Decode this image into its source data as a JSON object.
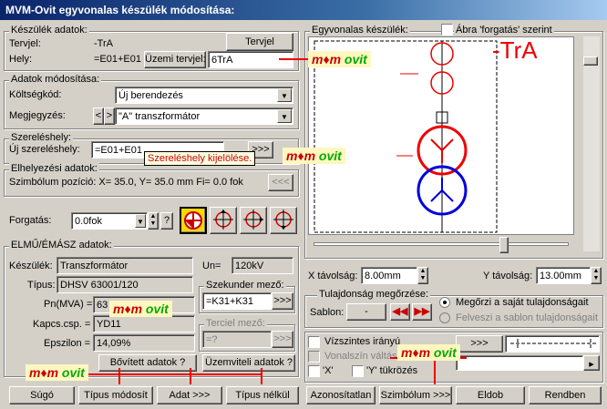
{
  "title": "MVM-Ovit egyvonalas készülék módosítása:",
  "keszulek": {
    "legend": "Készülék adatok:",
    "terv_label": "Tervjel:",
    "terv_value": "-TrA",
    "tervjel_button": "Tervjel",
    "hely_label": "Hely:",
    "hely_value": "=E01+E01",
    "uzemi_button": "Üzemi tervjel:",
    "uzemi_value": "6TrA"
  },
  "adatok": {
    "legend": "Adatok módosítása:",
    "koltseg_label": "Költségkód:",
    "koltseg_value": "Új berendezés",
    "megjegy_label": "Megjegyzés:",
    "prev": "<",
    "next": ">",
    "megjegy_value": "\"A\" transzformátor"
  },
  "szerelo": {
    "legend": "Szereléshely:",
    "uj_label": "Új szereléshely:",
    "uj_value": "=E01+E01",
    "pick": ">>>",
    "tooltip": "Szereléshely kijelölése."
  },
  "elhelyez": {
    "legend": "Elhelyezési adatok:",
    "text": "Szimbólum pozíció: X=  35.0, Y=  35.0 mm Fi=    0.0 fok",
    "back": "<<<"
  },
  "forgatas": {
    "label": "Forgatás:",
    "value": "0.0fok",
    "help": "?"
  },
  "elmu": {
    "legend": "ELMŰ/ÉMÁSZ adatok:",
    "keszulek_label": "Készülék:",
    "keszulek_value": "Transzformátor",
    "un_label": "Un=",
    "un_value": "120kV",
    "tipus_label": "Típus:",
    "tipus_value": "DHSV 63001/120",
    "pn_label": "Pn(MVA) =",
    "pn_value": "63",
    "kapcs_label": "Kapcs.csp. =",
    "kapcs_value": "YD11",
    "eps_label": "Epszilon =",
    "eps_value": "14,09%",
    "szek_legend": "Szekunder mező:",
    "szek_value": "=K31+K31",
    "szek_btn": ">>>",
    "terc_legend": "Terciel mező:",
    "terc_value": "=?",
    "terc_btn": ">>>",
    "bovitett": "Bővített adatok ?",
    "uzemviteli": "Üzemviteli adatok ?"
  },
  "preview": {
    "legend": "Egyvonalas készülék:",
    "abra_label": "Ábra 'forgatás' szerint",
    "tra_label": "-TrA"
  },
  "tavolsag": {
    "x_label": "X távolság:",
    "x_value": "8.00mm",
    "y_label": "Y távolság:",
    "y_value": "13.00mm"
  },
  "tulajdonsag": {
    "legend": "Tulajdonság megőrzése:",
    "sablon_label": "Sablon:",
    "sablon_value": "-",
    "opt1": "Megőrzi a saját tulajdonságait",
    "opt2": "Felveszi a sablon tulajdonságait"
  },
  "options": {
    "vizszintes": "Vízszintes irányú",
    "vonalszin": "Vonalszín váltás",
    "x_tukor": "'X'",
    "y_tukor": "'Y' tükrözés",
    "arrows": ">>>"
  },
  "logo": {
    "m": "m",
    "mid": "♦m",
    "text": " ovit"
  },
  "buttons": {
    "sugo": "Súgó",
    "tipus_mod": "Típus módosít",
    "adat": "Adat >>>",
    "tipus_nelkul": "Típus nélkül",
    "azonos": "Azonosítatlan",
    "szimbolum": "Szimbólum >>>",
    "eldob": "Eldob",
    "rendben": "Rendben"
  },
  "colors": {
    "accent_red": "#e00000",
    "blue": "#0000dd",
    "title_bar": "#0a246a"
  }
}
